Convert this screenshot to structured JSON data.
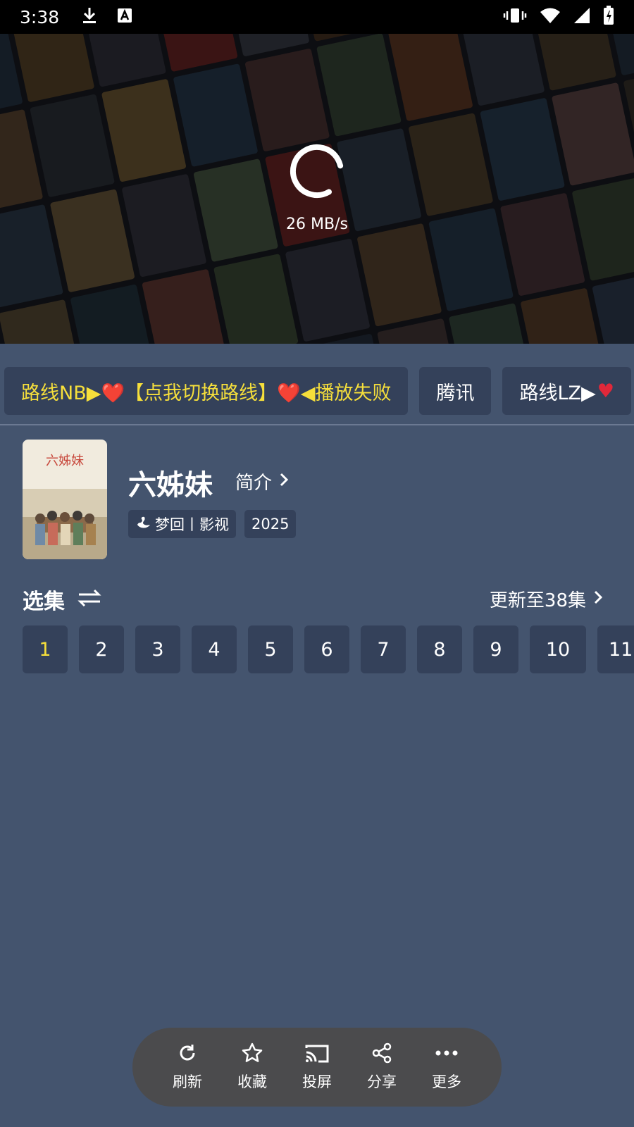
{
  "status_bar": {
    "time": "3:38"
  },
  "player": {
    "speed": "26 MB/s"
  },
  "routes": [
    {
      "label": "路线NB▶❤️【点我切换路线】❤️◀播放失败",
      "active": true
    },
    {
      "label": "腾讯",
      "active": false
    },
    {
      "label": "路线LZ▶",
      "active": false
    }
  ],
  "info": {
    "title": "六姊妹",
    "intro_label": "简介",
    "source_tag": "梦回丨影视",
    "year_tag": "2025",
    "cover_text": "六姊妹"
  },
  "episodes": {
    "title": "选集",
    "update_label": "更新至38集",
    "items": [
      "1",
      "2",
      "3",
      "4",
      "5",
      "6",
      "7",
      "8",
      "9",
      "10",
      "11"
    ],
    "selected": "1"
  },
  "actions": [
    {
      "label": "刷新",
      "icon": "refresh-icon"
    },
    {
      "label": "收藏",
      "icon": "star-icon"
    },
    {
      "label": "投屏",
      "icon": "cast-icon"
    },
    {
      "label": "分享",
      "icon": "share-icon"
    },
    {
      "label": "更多",
      "icon": "more-icon"
    }
  ],
  "colors": {
    "background": "#44546e",
    "chip": "#34415a",
    "accent": "#f6df3b",
    "action_bar": "#4b4b4d"
  }
}
